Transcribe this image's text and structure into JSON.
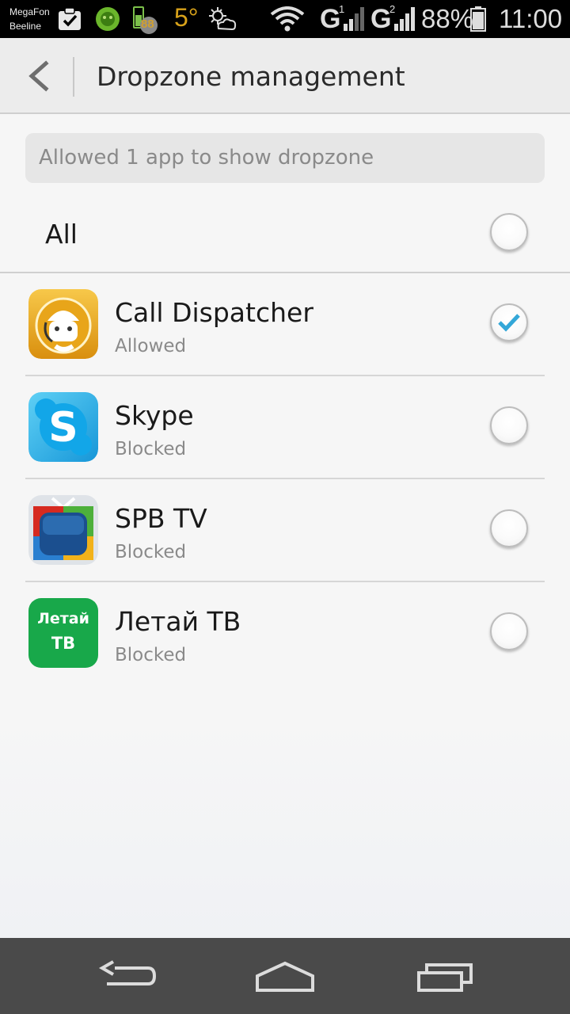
{
  "status_bar": {
    "carrier_1": "MegaFon",
    "carrier_2": "Beeline",
    "battery_badge": "88",
    "temperature": "5°",
    "sim_1_network": "G",
    "sim_1_index": "1",
    "sim_2_network": "G",
    "sim_2_index": "2",
    "battery_percent": "88%",
    "time": "11:00",
    "icons": [
      "task-check-icon",
      "shield-icon",
      "battery-saver-icon",
      "weather-icon",
      "wifi-icon",
      "signal-icon",
      "signal-icon",
      "battery-icon"
    ]
  },
  "header": {
    "title": "Dropzone management",
    "back_icon": "chevron-left-icon"
  },
  "summary_text": "Allowed 1 app to show dropzone",
  "all_toggle": {
    "label": "All",
    "checked": false
  },
  "apps": [
    {
      "name": "Call Dispatcher",
      "status": "Allowed",
      "checked": true,
      "icon": "call-dispatcher-icon"
    },
    {
      "name": "Skype",
      "status": "Blocked",
      "checked": false,
      "icon": "skype-icon"
    },
    {
      "name": "SPB TV",
      "status": "Blocked",
      "checked": false,
      "icon": "spb-tv-icon"
    },
    {
      "name": "Летай ТВ",
      "status": "Blocked",
      "checked": false,
      "icon": "letai-tv-icon",
      "icon_text_1": "Летай",
      "icon_text_2": "ТВ"
    }
  ],
  "nav_bar": {
    "buttons": [
      "back-icon",
      "home-icon",
      "recent-apps-icon"
    ]
  },
  "colors": {
    "check_accent": "#33a7d8",
    "header_bg": "#ececec",
    "navbar_bg": "#4a4a4a"
  }
}
